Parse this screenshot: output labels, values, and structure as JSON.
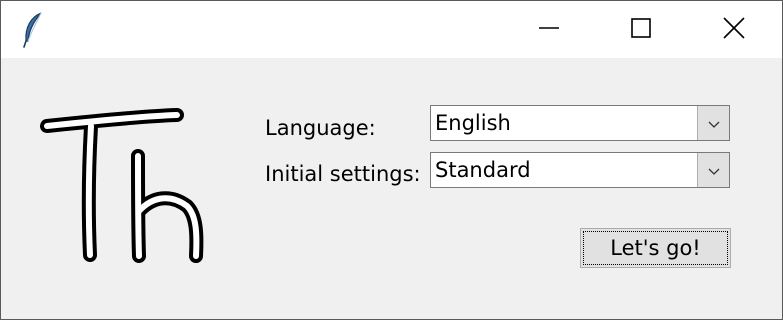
{
  "window": {
    "icons": {
      "app": "feather-icon",
      "minimize": "minimize-icon",
      "maximize": "maximize-icon",
      "close": "close-icon"
    }
  },
  "logo": {
    "text": "Th"
  },
  "form": {
    "language_label": "Language:",
    "language_value": "English",
    "initial_settings_label": "Initial settings:",
    "initial_settings_value": "Standard",
    "dropdown_icon": "chevron-down-icon"
  },
  "actions": {
    "go_label": "Let's go!"
  },
  "colors": {
    "window_bg": "#f0f0f0",
    "titlebar_bg": "#ffffff",
    "button_bg": "#e1e1e1",
    "feather_blue": "#3a6ea5"
  }
}
